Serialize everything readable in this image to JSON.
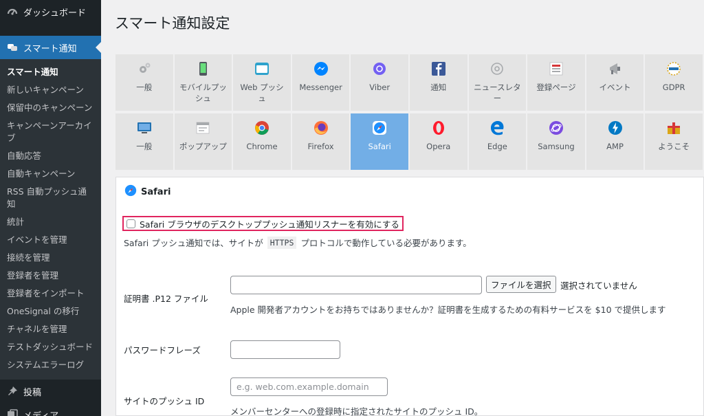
{
  "sidebar": {
    "dashboard": "ダッシュボード",
    "smart_notify": "スマート通知",
    "submenu": [
      "スマート通知",
      "新しいキャンペーン",
      "保留中のキャンペーン",
      "キャンペーンアーカイブ",
      "自動応答",
      "自動キャンペーン",
      "RSS 自動プッシュ通知",
      "統計",
      "イベントを管理",
      "接続を管理",
      "登録者を管理",
      "登録者をインポート",
      "OneSignal の移行",
      "チャネルを管理",
      "テストダッシュボード",
      "システムエラーログ"
    ],
    "posts": "投稿",
    "media": "メディア"
  },
  "page_title": "スマート通知設定",
  "tabs_row1": [
    {
      "label": "一般",
      "icon": "gear-icon"
    },
    {
      "label": "モバイルプッシュ",
      "icon": "mobile-icon"
    },
    {
      "label": "Web プッシュ",
      "icon": "browser-icon"
    },
    {
      "label": "Messenger",
      "icon": "messenger-icon"
    },
    {
      "label": "Viber",
      "icon": "viber-icon"
    },
    {
      "label": "通知",
      "icon": "facebook-icon"
    },
    {
      "label": "ニュースレター",
      "icon": "at-icon"
    },
    {
      "label": "登録ページ",
      "icon": "form-icon"
    },
    {
      "label": "イベント",
      "icon": "megaphone-icon"
    },
    {
      "label": "GDPR",
      "icon": "gdpr-icon"
    }
  ],
  "tabs_row2": [
    {
      "label": "一般",
      "icon": "monitor-icon"
    },
    {
      "label": "ポップアップ",
      "icon": "popup-icon"
    },
    {
      "label": "Chrome",
      "icon": "chrome-icon"
    },
    {
      "label": "Firefox",
      "icon": "firefox-icon"
    },
    {
      "label": "Safari",
      "icon": "safari-icon"
    },
    {
      "label": "Opera",
      "icon": "opera-icon"
    },
    {
      "label": "Edge",
      "icon": "edge-icon"
    },
    {
      "label": "Samsung",
      "icon": "samsung-icon"
    },
    {
      "label": "AMP",
      "icon": "amp-icon"
    },
    {
      "label": "ようこそ",
      "icon": "welcome-icon"
    }
  ],
  "panel": {
    "title": "Safari",
    "enable_label": "Safari ブラウザのデスクトッププッシュ通知リスナーを有効にする",
    "notice_prefix": "Safari プッシュ通知では、サイトが",
    "notice_code": "HTTPS",
    "notice_suffix": "プロトコルで動作している必要があります。",
    "cert_label": "証明書 .P12 ファイル",
    "file_button": "ファイルを選択",
    "file_status": "選択されていません",
    "cert_help": "Apple 開発者アカウントをお持ちではありませんか？証明書を生成するための有料サービスを $10 で提供します",
    "passphrase_label": "パスワードフレーズ",
    "push_id_label": "サイトのプッシュ ID",
    "push_id_placeholder": "e.g. web.com.example.domain",
    "push_id_help": "メンバーセンターへの登録時に指定されたサイトのプッシュ ID。"
  }
}
